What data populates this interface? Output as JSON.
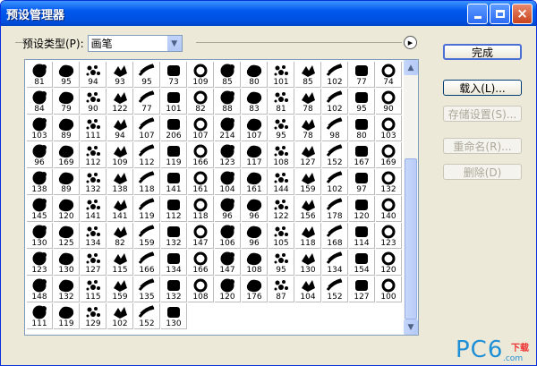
{
  "window": {
    "title": "预设管理器"
  },
  "preset": {
    "label": "预设类型(P):",
    "value": "画笔"
  },
  "buttons": {
    "done": "完成",
    "load": "载入(L)...",
    "save_set": "存储设置(S)...",
    "rename": "重命名(R)...",
    "delete": "删除(D)"
  },
  "brushes": [
    "81",
    "95",
    "94",
    "93",
    "95",
    "73",
    "109",
    "85",
    "80",
    "101",
    "85",
    "102",
    "77",
    "74",
    "84",
    "79",
    "90",
    "122",
    "77",
    "101",
    "82",
    "88",
    "83",
    "81",
    "78",
    "102",
    "95",
    "90",
    "103",
    "89",
    "111",
    "94",
    "107",
    "206",
    "107",
    "214",
    "107",
    "95",
    "78",
    "98",
    "80",
    "103",
    "96",
    "169",
    "112",
    "109",
    "112",
    "119",
    "166",
    "123",
    "117",
    "108",
    "127",
    "152",
    "167",
    "169",
    "138",
    "89",
    "132",
    "138",
    "118",
    "141",
    "161",
    "104",
    "161",
    "144",
    "159",
    "102",
    "97",
    "132",
    "145",
    "120",
    "141",
    "141",
    "119",
    "112",
    "118",
    "96",
    "96",
    "122",
    "156",
    "178",
    "120",
    "140",
    "130",
    "125",
    "134",
    "82",
    "159",
    "132",
    "147",
    "106",
    "96",
    "105",
    "118",
    "168",
    "114",
    "123",
    "123",
    "130",
    "127",
    "115",
    "166",
    "134",
    "166",
    "147",
    "108",
    "95",
    "130",
    "134",
    "154",
    "120",
    "148",
    "132",
    "115",
    "159",
    "135",
    "132",
    "108",
    "120",
    "176",
    "87",
    "104",
    "152",
    "127",
    "100",
    "111",
    "119",
    "129",
    "102",
    "152",
    "130"
  ],
  "watermark": {
    "brand": "PC6",
    "tag": "下载",
    "domain": ".com"
  }
}
